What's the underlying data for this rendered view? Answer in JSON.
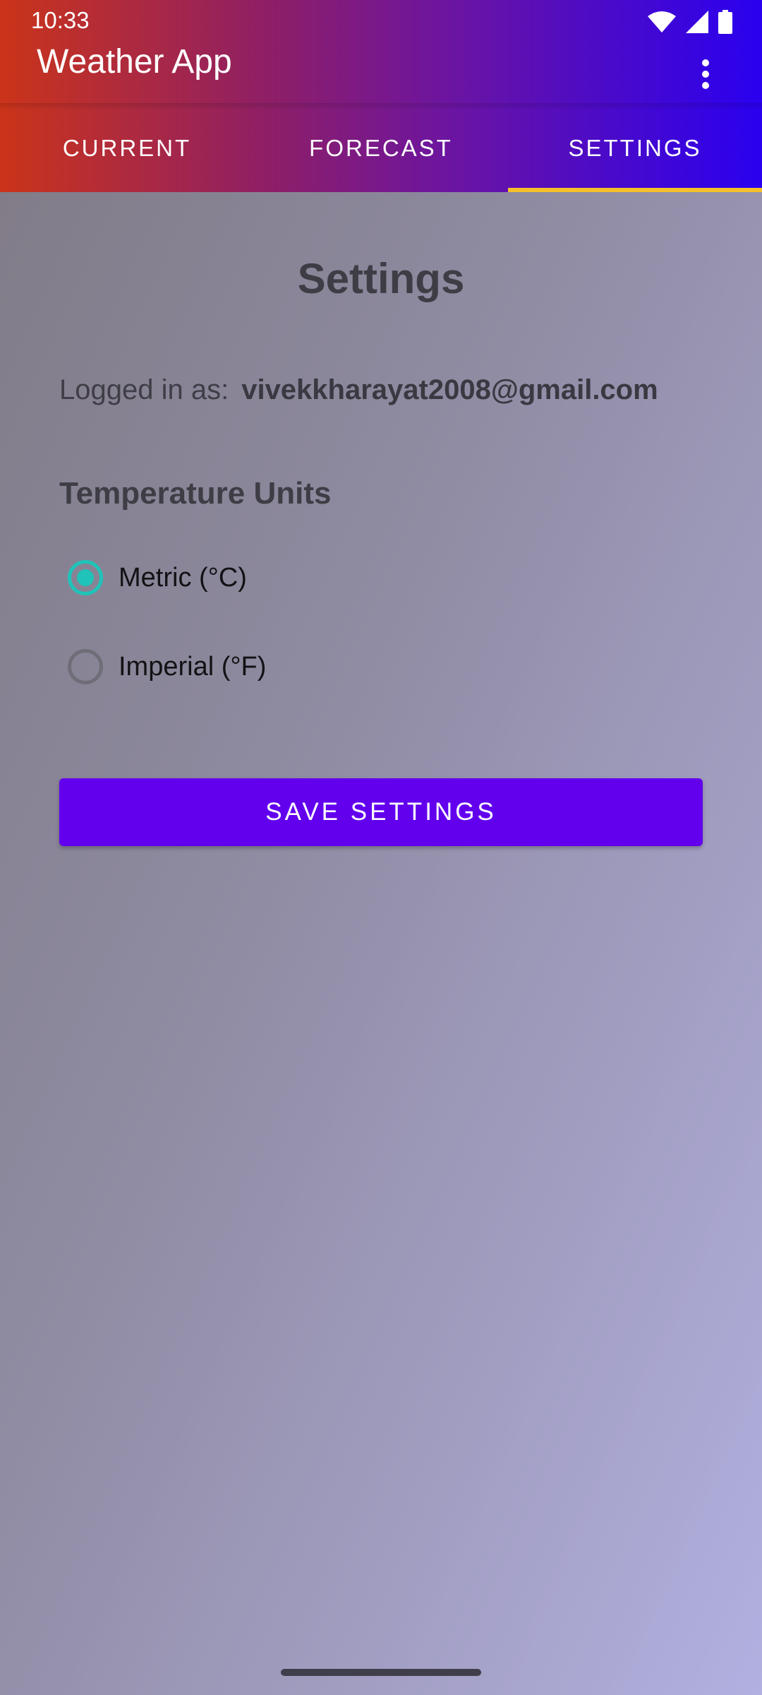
{
  "status_bar": {
    "time": "10:33",
    "icons": [
      "wifi-icon",
      "signal-icon",
      "battery-icon"
    ]
  },
  "app_bar": {
    "title": "Weather App",
    "overflow_icon": "more-vert-icon"
  },
  "tabs": [
    {
      "label": "CURRENT",
      "active": false
    },
    {
      "label": "FORECAST",
      "active": false
    },
    {
      "label": "SETTINGS",
      "active": true
    }
  ],
  "settings": {
    "title": "Settings",
    "logged_in_label": "Logged in as:",
    "email": "vivekkharayat2008@gmail.com",
    "units_title": "Temperature Units",
    "units_options": [
      {
        "label": "Metric (°C)",
        "selected": true
      },
      {
        "label": "Imperial (°F)",
        "selected": false
      }
    ],
    "save_label": "SAVE SETTINGS"
  },
  "colors": {
    "accent": "#6200ee",
    "radio_selected": "#20c3b8",
    "tab_indicator": "#f5c02a"
  }
}
